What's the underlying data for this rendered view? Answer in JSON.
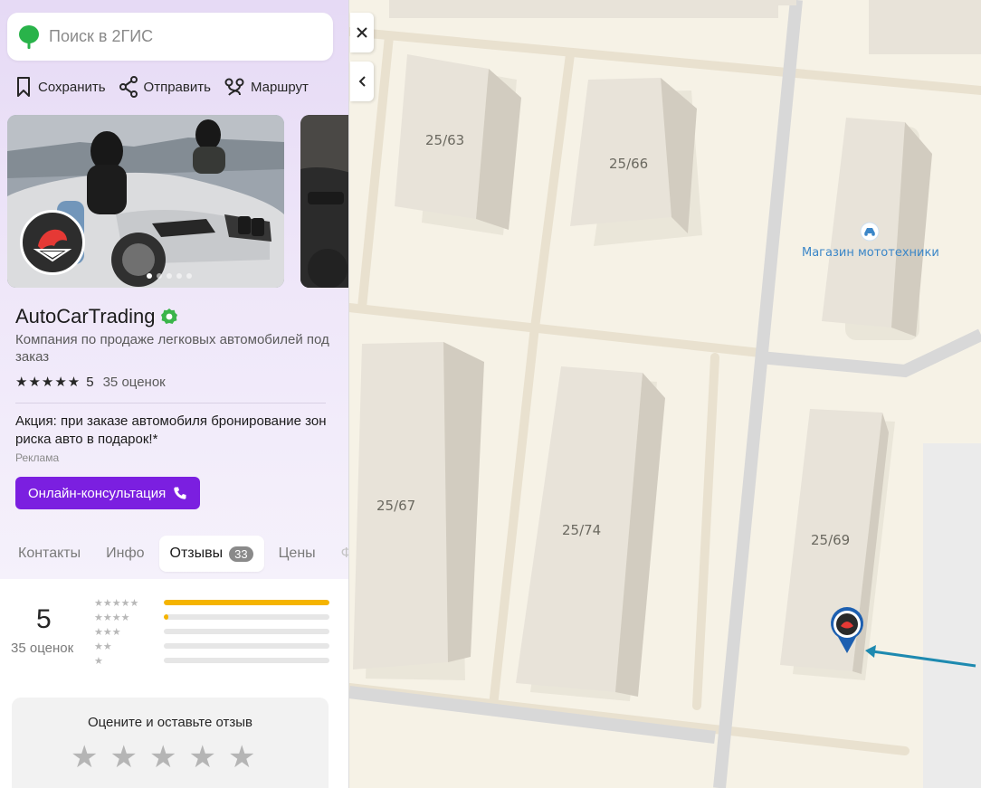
{
  "search": {
    "placeholder": "Поиск в 2ГИС"
  },
  "actions": {
    "save": "Сохранить",
    "share": "Отправить",
    "route": "Маршрут"
  },
  "gallery": {
    "photo_count": 5,
    "active_index": 0
  },
  "firm": {
    "name": "AutoCarTrading",
    "subtitle": "Компания по продаже легковых автомобилей под заказ",
    "rating": "5",
    "rating_count": "35 оценок",
    "stars": "★★★★★",
    "promo": "Акция: при заказе автомобиля бронирование зон риска авто в подарок!*",
    "ad_label": "Реклама",
    "cta": "Онлайн-консультация"
  },
  "tabs": [
    {
      "label": "Контакты"
    },
    {
      "label": "Инфо"
    },
    {
      "label": "Отзывы",
      "badge": "33"
    },
    {
      "label": "Цены"
    },
    {
      "label": "Ф"
    }
  ],
  "summary": {
    "score": "5",
    "count": "35 оценок",
    "histogram": [
      {
        "stars": "★★★★★",
        "fraction": 1.0
      },
      {
        "stars": "★★★★",
        "fraction": 0.03
      },
      {
        "stars": "★★★",
        "fraction": 0
      },
      {
        "stars": "★★",
        "fraction": 0
      },
      {
        "stars": "★",
        "fraction": 0
      }
    ]
  },
  "rate": {
    "title": "Оцените и оставьте отзыв",
    "star": "★"
  },
  "map": {
    "buildings": [
      "25/63",
      "25/66",
      "25/67",
      "25/74",
      "25/69"
    ],
    "poi": "Магазин мототехники"
  },
  "colors": {
    "accent": "#7b1fe0",
    "star_fill": "#f5b400",
    "verified": "#3bb54a",
    "poi": "#3a86c8"
  }
}
